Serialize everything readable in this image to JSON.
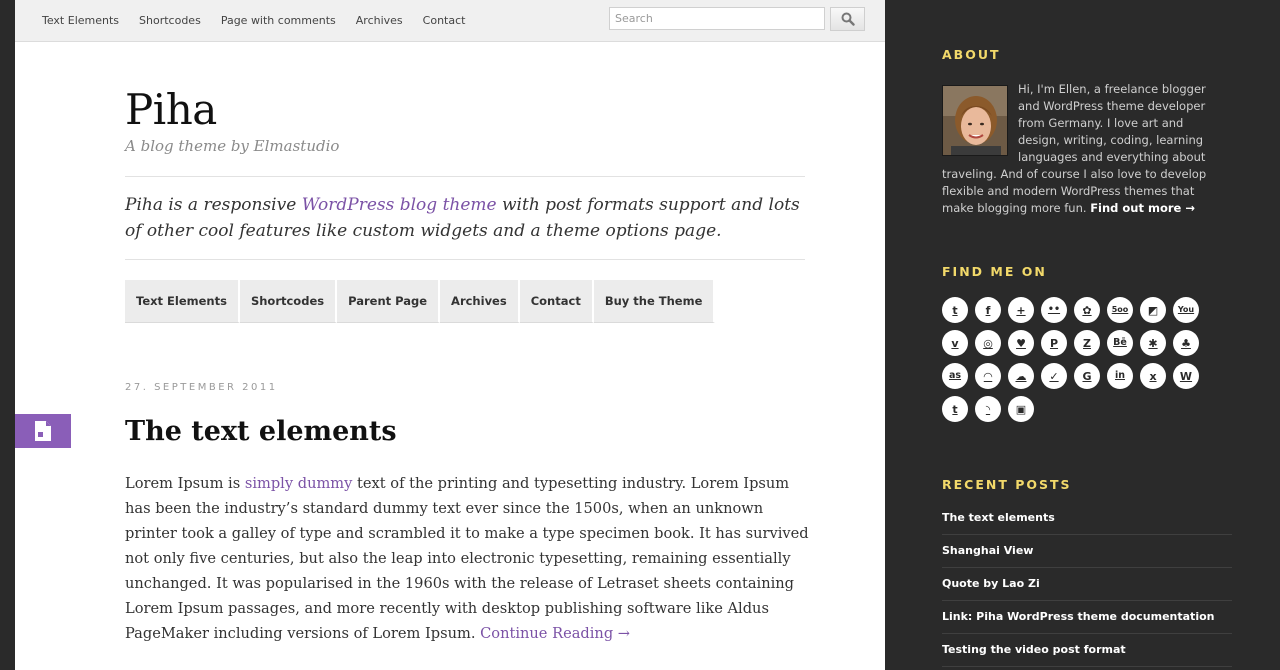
{
  "topbar": {
    "nav": [
      "Text Elements",
      "Shortcodes",
      "Page with comments",
      "Archives",
      "Contact"
    ],
    "search_placeholder": "Search",
    "search_button": "search-icon"
  },
  "header": {
    "title": "Piha",
    "tagline": "A blog theme by Elmastudio",
    "intro_before": "Piha is a responsive ",
    "intro_link": "WordPress blog theme",
    "intro_after": " with post formats support and lots of other cool features like custom widgets and a theme options page."
  },
  "main_menu": [
    "Text Elements",
    "Shortcodes",
    "Parent Page",
    "Archives",
    "Contact",
    "Buy the Theme"
  ],
  "post": {
    "date": "27. SEPTEMBER 2011",
    "format_icon": "document-icon",
    "title": "The text elements",
    "body_before": "Lorem Ipsum is ",
    "body_link": "simply dummy",
    "body_after": " text of the printing and typesetting industry. Lorem Ipsum has been the industry’s standard dummy text ever since the 1500s, when an unknown printer took a galley of type and scrambled it to make a type specimen book. It has survived not only five centuries, but also the leap into electronic typesetting, remaining essentially unchanged. It was popularised in the 1960s with the release of Letraset sheets containing Lorem Ipsum passages, and more recently with desktop publishing software like Aldus PageMaker including versions of Lorem Ipsum. ",
    "continue_link": "Continue Reading →"
  },
  "sidebar": {
    "about": {
      "title": "ABOUT",
      "text": "Hi, I'm Ellen, a freelance blogger and WordPress theme developer from Germany. I love art and design, writing, coding, learning languages and everything about traveling. And of course I also love to develop flexible and modern WordPress themes that make blogging more fun. ",
      "link": "Find out more →"
    },
    "find_me": {
      "title": "FIND ME ON",
      "icons": [
        [
          "twitter-icon",
          "facebook-icon",
          "google-plus-icon",
          "flickr-icon",
          "picasa-icon",
          "500px-icon",
          "delicious-icon",
          "youtube-icon"
        ],
        [
          "vimeo-icon",
          "dribbble-icon",
          "heart-icon",
          "pinterest-icon",
          "zootool-icon",
          "behance-icon",
          "bug-icon",
          "spotify-icon"
        ],
        [
          "lastfm-icon",
          "path-icon",
          "soundcloud-icon",
          "forrst-icon",
          "github-icon",
          "linkedin-icon",
          "xing-icon",
          "wordpress-icon"
        ],
        [
          "tumblr-icon",
          "rss-icon",
          "comments-rss-icon"
        ]
      ],
      "glyphs": {
        "twitter-icon": "t",
        "facebook-icon": "f",
        "google-plus-icon": "+",
        "flickr-icon": "••",
        "picasa-icon": "✿",
        "500px-icon": "5oo",
        "delicious-icon": "◩",
        "youtube-icon": "You",
        "vimeo-icon": "v",
        "dribbble-icon": "◎",
        "heart-icon": "♥",
        "pinterest-icon": "P",
        "zootool-icon": "Z",
        "behance-icon": "Bē",
        "bug-icon": "✱",
        "spotify-icon": "♣",
        "lastfm-icon": "as",
        "path-icon": "◠",
        "soundcloud-icon": "☁",
        "forrst-icon": "✓",
        "github-icon": "G",
        "linkedin-icon": "in",
        "xing-icon": "x",
        "wordpress-icon": "W",
        "tumblr-icon": "t",
        "rss-icon": "◝",
        "comments-rss-icon": "▣"
      }
    },
    "recent_posts": {
      "title": "RECENT POSTS",
      "items": [
        "The text elements",
        "Shanghai View",
        "Quote by Lao Zi",
        "Link: Piha WordPress theme documentation",
        "Testing the video post format"
      ]
    }
  },
  "colors": {
    "accent_link": "#7b52a6",
    "format_tab": "#8a5eb8",
    "sidebar_bg": "#2a2a2a",
    "widget_title": "#f2d96a"
  }
}
